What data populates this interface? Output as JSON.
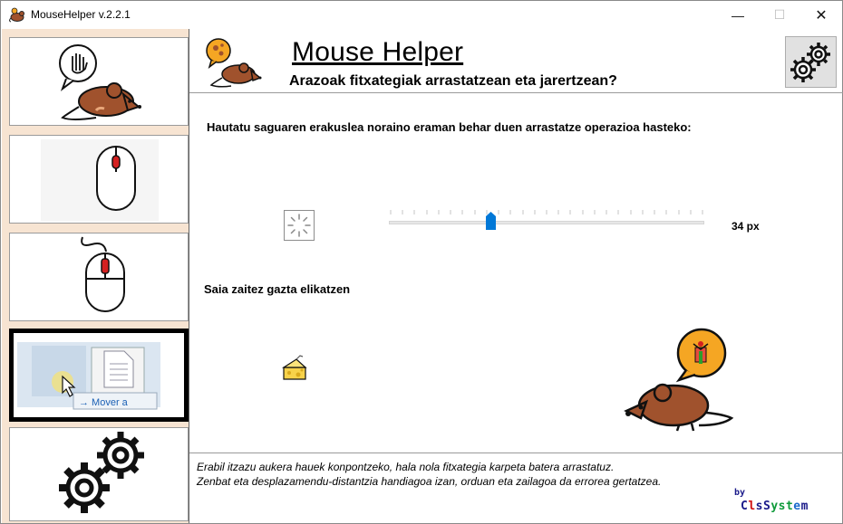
{
  "window": {
    "title": "MouseHelper v.2.2.1",
    "minimize_glyph": "—",
    "maximize_glyph": "☐",
    "close_glyph": "✕"
  },
  "sidebar": {
    "items": [
      {
        "name": "drag-drop-help",
        "icon": "hand-mouse-icon"
      },
      {
        "name": "left-click",
        "icon": "mouse-left-click-icon"
      },
      {
        "name": "double-click",
        "icon": "mouse-double-click-icon"
      },
      {
        "name": "drag-move",
        "icon": "drag-move-screenshot-icon",
        "selected": true,
        "caption": "Mover a"
      },
      {
        "name": "settings",
        "icon": "gears-icon"
      }
    ]
  },
  "header": {
    "title": "Mouse Helper",
    "subtitle": "Arazoak fitxategiak arrastatzean eta jarertzean?"
  },
  "main": {
    "instruction": "Hautatu saguaren erakuslea noraino eraman behar duen arrastatze operazioa hasteko:",
    "slider": {
      "value": 34,
      "min": 0,
      "max": 100,
      "unit": "px",
      "value_label": "34 px"
    },
    "cheese_label": "Saia zaitez gazta elikatzen"
  },
  "footer": {
    "line1": "Erabil itzazu aukera hauek konpontzeko, hala nola fitxategia karpeta batera arrastatuz.",
    "line2": "Zenbat eta desplazamendu-distantzia handiagoa izan, orduan eta zailagoa da errorea gertatzea.",
    "by": "by",
    "brand": "ClsSystem",
    "brand_colors": [
      "#1a1a8a",
      "#d01010",
      "#1a1a8a",
      "#1a1a8a",
      "#0f9a3a",
      "#0f9a3a",
      "#0f9a3a",
      "#1a6acc",
      "#1a1a8a"
    ]
  },
  "colors": {
    "sidebar_bg": "#f7e4d2",
    "mouse_brown": "#a0522d",
    "accent_blue": "#0078d7",
    "bubble_orange": "#f5a623"
  }
}
